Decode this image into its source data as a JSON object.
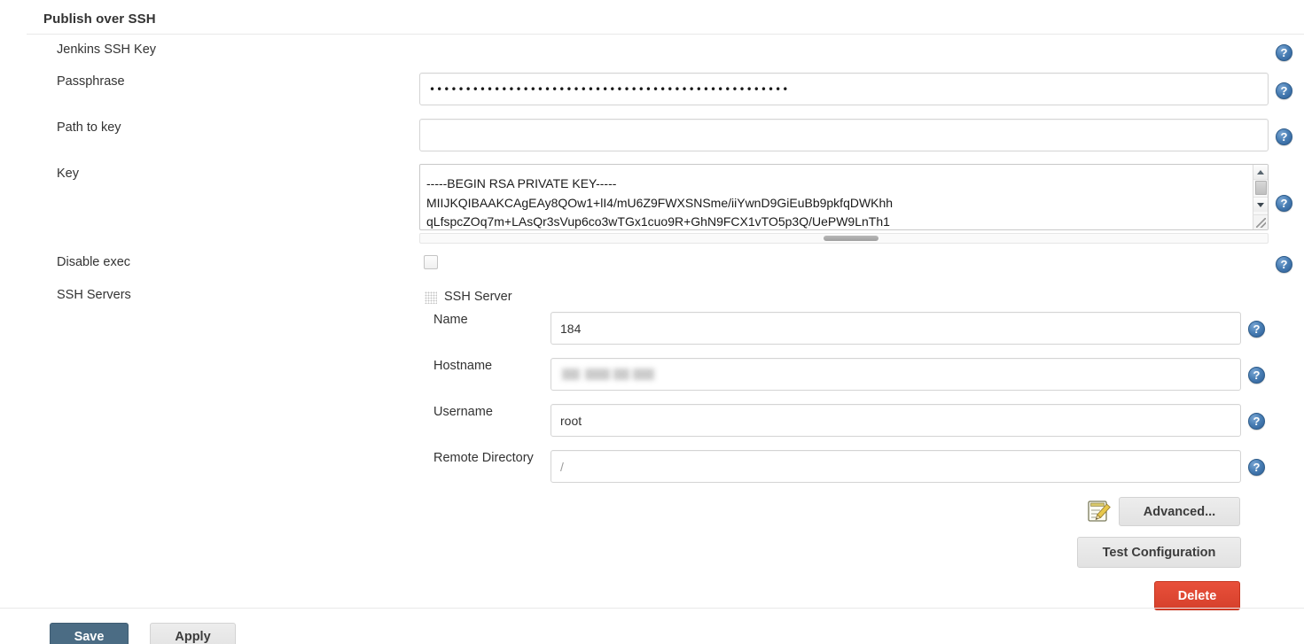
{
  "section": {
    "title": "Publish over SSH"
  },
  "fields": {
    "jenkins_ssh_key": {
      "label": "Jenkins SSH Key"
    },
    "passphrase": {
      "label": "Passphrase",
      "value": "••••••••••••••••••••••••••••••••••••••••••••••••••",
      "masked": true
    },
    "path_to_key": {
      "label": "Path to key",
      "value": "",
      "placeholder": ""
    },
    "key": {
      "label": "Key",
      "value": "-----BEGIN RSA PRIVATE KEY-----\nMIIJKQIBAAKCAgEAy8QOw1+lI4/mU6Z9FWXSNSme/iiYwnD9GiEuBb9pkfqDWKhh\nqLfspcZOq7m+LAsQr3sVup6co3wTGx1cuo9R+GhN9FCX1vTO5p3Q/UePW9LnTh1"
    },
    "disable_exec": {
      "label": "Disable exec",
      "checked": false
    },
    "ssh_servers": {
      "label": "SSH Servers"
    }
  },
  "ssh_server": {
    "title": "SSH Server",
    "name": {
      "label": "Name",
      "value": "184"
    },
    "hostname": {
      "label": "Hostname",
      "value": ""
    },
    "username": {
      "label": "Username",
      "value": "root"
    },
    "remote_directory": {
      "label": "Remote Directory",
      "value": "/"
    },
    "buttons": {
      "advanced": "Advanced...",
      "test_configuration": "Test Configuration",
      "delete": "Delete"
    }
  },
  "footer": {
    "save": "Save",
    "apply": "Apply"
  },
  "icons": {
    "help": "?"
  },
  "colors": {
    "save_blue": "#4b6c84",
    "delete_red": "#d6402c",
    "help_blue": "#2c5d96",
    "text": "#333333"
  }
}
